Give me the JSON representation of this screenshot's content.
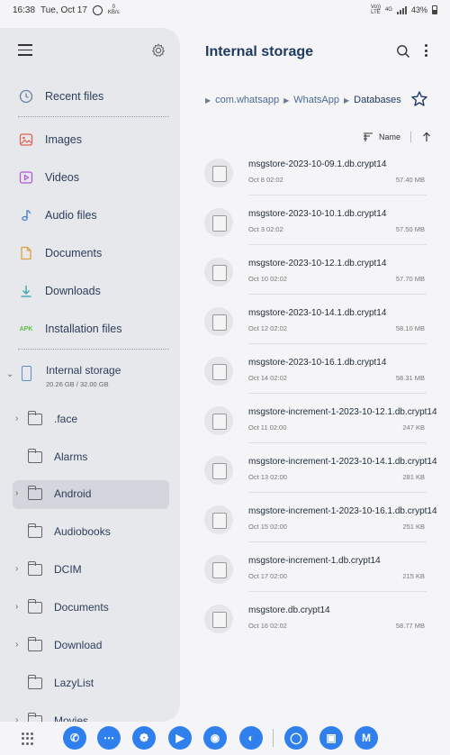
{
  "status_bar": {
    "time": "16:38",
    "date": "Tue, Oct 17",
    "net_speed_value": "0",
    "net_speed_unit": "KB/s",
    "volte": "Vo))",
    "lte": "LTE",
    "network": "4G",
    "battery": "43%"
  },
  "drawer": {
    "nav": [
      {
        "label": "Recent files",
        "icon": "clock-icon"
      },
      {
        "label": "Images",
        "icon": "image-icon"
      },
      {
        "label": "Videos",
        "icon": "video-icon"
      },
      {
        "label": "Audio files",
        "icon": "music-note-icon"
      },
      {
        "label": "Documents",
        "icon": "document-icon"
      },
      {
        "label": "Downloads",
        "icon": "download-icon"
      },
      {
        "label": "Installation files",
        "icon": "apk-icon",
        "icon_text": "APK"
      }
    ],
    "storage": {
      "title": "Internal storage",
      "usage": "20.26 GB / 32.00 GB"
    },
    "folders": [
      {
        "label": ".face",
        "expandable": true
      },
      {
        "label": "Alarms",
        "expandable": false
      },
      {
        "label": "Android",
        "expandable": true,
        "selected": true
      },
      {
        "label": "Audiobooks",
        "expandable": false
      },
      {
        "label": "DCIM",
        "expandable": true
      },
      {
        "label": "Documents",
        "expandable": true
      },
      {
        "label": "Download",
        "expandable": true
      },
      {
        "label": "LazyList",
        "expandable": false
      },
      {
        "label": "Movies",
        "expandable": true
      }
    ]
  },
  "main": {
    "title": "Internal storage",
    "breadcrumb": [
      "com.whatsapp",
      "WhatsApp",
      "Databases"
    ],
    "sort_label": "Name",
    "files": [
      {
        "name": "msgstore-2023-10-09.1.db.crypt14",
        "date": "Oct 8 02:02",
        "size": "57.40 MB"
      },
      {
        "name": "msgstore-2023-10-10.1.db.crypt14",
        "date": "Oct 3 02:02",
        "size": "57.50 MB"
      },
      {
        "name": "msgstore-2023-10-12.1.db.crypt14",
        "date": "Oct 10 02:02",
        "size": "57.70 MB"
      },
      {
        "name": "msgstore-2023-10-14.1.db.crypt14",
        "date": "Oct 12 02:02",
        "size": "58.10 MB"
      },
      {
        "name": "msgstore-2023-10-16.1.db.crypt14",
        "date": "Oct 14 02:02",
        "size": "58.31 MB"
      },
      {
        "name": "msgstore-increment-1-2023-10-12.1.db.crypt14",
        "date": "Oct 11 02:00",
        "size": "247 KB"
      },
      {
        "name": "msgstore-increment-1-2023-10-14.1.db.crypt14",
        "date": "Oct 13 02:00",
        "size": "281 KB"
      },
      {
        "name": "msgstore-increment-1-2023-10-16.1.db.crypt14",
        "date": "Oct 15 02:00",
        "size": "251 KB"
      },
      {
        "name": "msgstore-increment-1.db.crypt14",
        "date": "Oct 17 02:00",
        "size": "215 KB"
      },
      {
        "name": "msgstore.db.crypt14",
        "date": "Oct 16 02:02",
        "size": "58.77 MB"
      }
    ]
  },
  "dock": {
    "apps": [
      {
        "name": "phone-app-icon",
        "color": "#2f80ed"
      },
      {
        "name": "messages-app-icon",
        "color": "#2f80ed"
      },
      {
        "name": "bixby-app-icon",
        "color": "#2f80ed"
      },
      {
        "name": "play-store-app-icon",
        "color": "#2f80ed"
      },
      {
        "name": "camera-app-icon",
        "color": "#2f80ed"
      },
      {
        "name": "internet-app-icon",
        "color": "#2f80ed"
      },
      {
        "name": "recent-app-icon",
        "color": "#2f80ed"
      },
      {
        "name": "store-app-icon",
        "color": "#2f80ed"
      },
      {
        "name": "mail-app-icon",
        "color": "#2f80ed"
      }
    ]
  },
  "colors": {
    "accent": "#1f3a64",
    "link": "#4a6a94",
    "dock_app": "#2f80ed"
  }
}
